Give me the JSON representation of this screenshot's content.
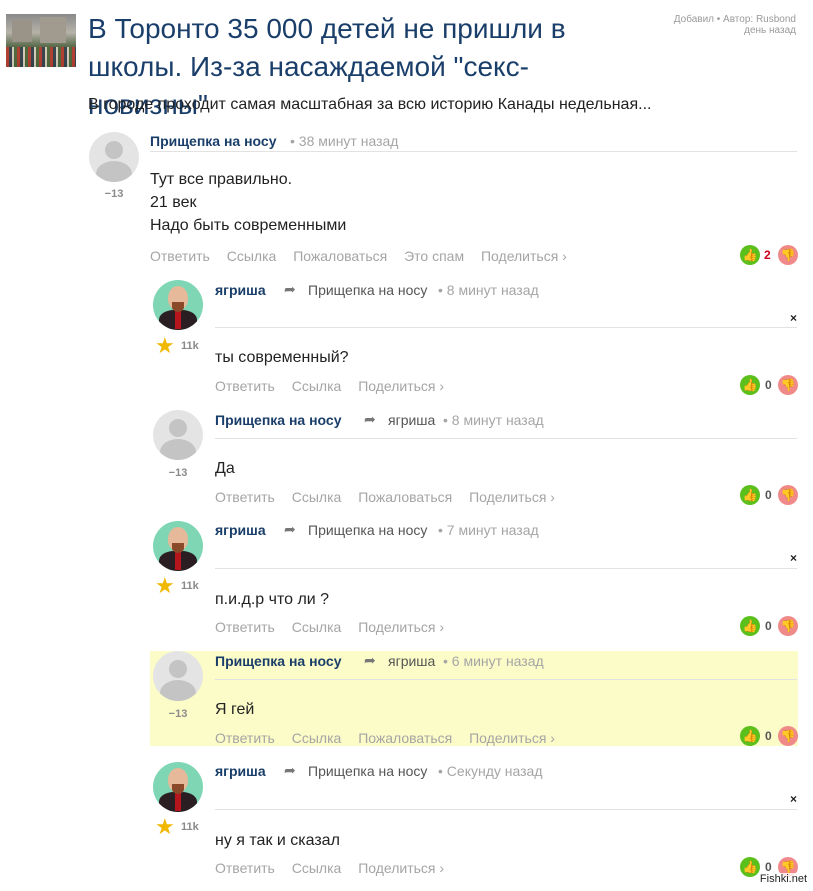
{
  "article": {
    "title": "В Торонто 35 000 детей не пришли в школы. Из-за насаждаемой \"секс-новизны\"",
    "meta_line1": "Добавил • Автор: Rusbond",
    "meta_line2": "день назад",
    "lead": "В городе проходит самая масштабная за всю историю Канады недельная..."
  },
  "actions": {
    "reply": "Ответить",
    "link": "Ссылка",
    "report": "Пожаловаться",
    "spam": "Это спам",
    "share": "Поделиться ›"
  },
  "comments": [
    {
      "author": "Прищепка на носу",
      "time": "• 38 минут назад",
      "score": "−13",
      "text": "Тут все правильно.\n21 век\nНадо быть современными",
      "votes": "2"
    },
    {
      "author": "ягриша",
      "reply_to": "Прищепка на носу",
      "time": "• 8 минут назад",
      "rank": "11k",
      "text": "ты современный?",
      "votes": "0"
    },
    {
      "author": "Прищепка на носу",
      "reply_to": "ягриша",
      "time": "• 8 минут назад",
      "score": "−13",
      "text": "Да",
      "votes": "0"
    },
    {
      "author": "ягриша",
      "reply_to": "Прищепка на носу",
      "time": "• 7 минут назад",
      "rank": "11k",
      "text": "п.и.д.р что ли ?",
      "votes": "0"
    },
    {
      "author": "Прищепка на носу",
      "reply_to": "ягриша",
      "time": "• 6 минут назад",
      "score": "−13",
      "text": "Я гей",
      "votes": "0"
    },
    {
      "author": "ягриша",
      "reply_to": "Прищепка на носу",
      "time": "• Секунду назад",
      "rank": "11k",
      "text": "ну я так и сказал",
      "votes": "0"
    }
  ],
  "watermark": "Fishki.net",
  "colors": {
    "link": "#1a3e6a",
    "upvote": "#5bbf1c",
    "downvote": "#f08a8a",
    "highlight": "#fcfcc8"
  }
}
